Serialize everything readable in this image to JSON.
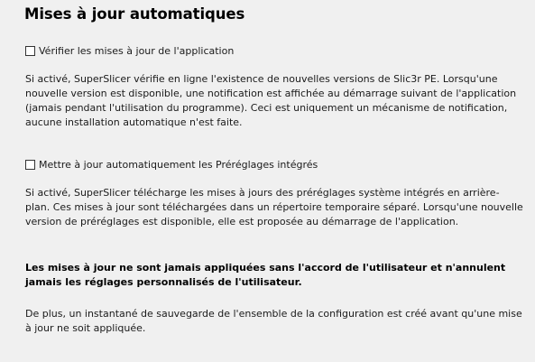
{
  "section": {
    "title": "Mises à jour automatiques"
  },
  "app_update": {
    "checkbox_label": "Vérifier les mises à jour de l'application",
    "checked": false,
    "description": "Si activé, SuperSlicer vérifie en ligne l'existence de nouvelles versions de Slic3r PE. Lorsqu'une nouvelle version est disponible, une notification est affichée au démarrage suivant de l'application (jamais pendant l'utilisation du programme). Ceci est uniquement un mécanisme de notification, aucune installation automatique n'est faite."
  },
  "preset_update": {
    "checkbox_label": "Mettre à jour automatiquement les Préréglages intégrés",
    "checked": false,
    "description": "Si activé, SuperSlicer télécharge les mises à jours des préréglages système intégrés en arrière-plan. Ces mises à jour sont téléchargées dans un répertoire temporaire séparé. Lorsqu'une nouvelle version de préréglages est disponible, elle est proposée au démarrage de l'application."
  },
  "notes": {
    "warning": "Les mises à jour ne sont jamais appliquées sans l'accord de l'utilisateur et n'annulent jamais les réglages personnalisés de l'utilisateur.",
    "snapshot": "De plus, un instantané de sauvegarde de l'ensemble de la configuration est créé avant qu'une mise à jour ne soit appliquée."
  }
}
